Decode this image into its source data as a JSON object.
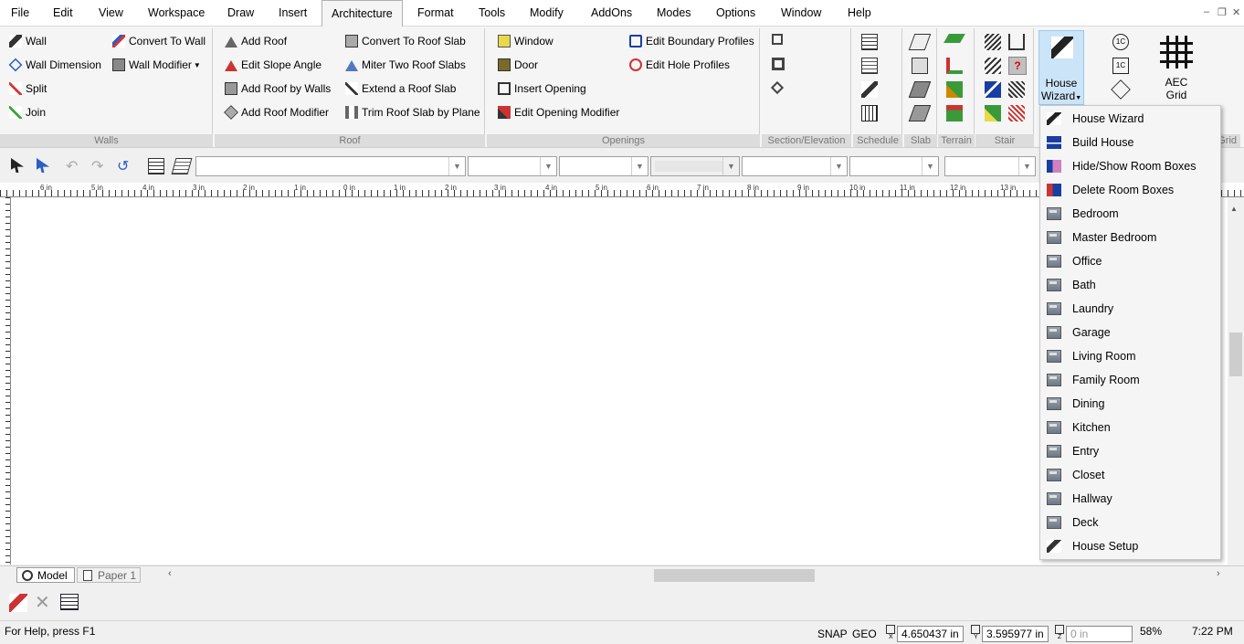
{
  "menu": {
    "items": [
      "File",
      "Edit",
      "View",
      "Workspace",
      "Draw",
      "Insert",
      "Architecture",
      "Format",
      "Tools",
      "Modify",
      "AddOns",
      "Modes",
      "Options",
      "Window",
      "Help"
    ]
  },
  "window_controls": {
    "minimize": "–",
    "restore": "❐",
    "close": "✕"
  },
  "ribbon": {
    "walls": {
      "label": "Walls",
      "wall": "Wall",
      "wall_dimension": "Wall Dimension",
      "split": "Split",
      "join": "Join",
      "convert_to_wall": "Convert To Wall",
      "wall_modifier": "Wall Modifier"
    },
    "roof": {
      "label": "Roof",
      "add_roof": "Add Roof",
      "edit_slope_angle": "Edit Slope Angle",
      "add_roof_by_walls": "Add Roof by Walls",
      "add_roof_modifier": "Add Roof Modifier",
      "convert_to_roof_slab": "Convert To Roof Slab",
      "miter_two_roof_slabs": "Miter Two Roof Slabs",
      "extend_a_roof_slab": "Extend a Roof Slab",
      "trim_roof_slab_by_plane": "Trim Roof Slab by Plane"
    },
    "openings": {
      "label": "Openings",
      "window": "Window",
      "door": "Door",
      "insert_opening": "Insert Opening",
      "edit_opening_modifier": "Edit Opening Modifier",
      "edit_boundary_profiles": "Edit Boundary Profiles",
      "edit_hole_profiles": "Edit Hole Profiles"
    },
    "section": {
      "label": "Section/Elevation"
    },
    "schedule": {
      "label": "Schedule"
    },
    "slab": {
      "label": "Slab"
    },
    "terrain": {
      "label": "Terrain"
    },
    "stair": {
      "label": "Stair"
    },
    "house_wizard": {
      "label_line1": "House",
      "label_line2": "Wizard"
    },
    "aec_grid": {
      "label_line1": "AEC",
      "label_line2": "Grid",
      "group_label_partial": "Grid"
    }
  },
  "ruler": {
    "labels": [
      "6 in",
      "5 in",
      "4 in",
      "3 in",
      "2 in",
      "1 in",
      "0 in",
      "1 in",
      "2 in",
      "3 in",
      "4 in",
      "5 in",
      "6 in",
      "7 in",
      "8 in",
      "9 in",
      "10 in",
      "11 in",
      "12 in",
      "13 in"
    ]
  },
  "tabs": {
    "model": "Model",
    "paper1": "Paper 1"
  },
  "status": {
    "help": "For Help, press F1",
    "snap": "SNAP",
    "geo": "GEO",
    "x_label": "X",
    "x_value": "4.650437 in",
    "y_label": "Y",
    "y_value": "3.595977 in",
    "z_label": "Z",
    "z_placeholder": "0 in",
    "zoom": "58%",
    "time": "7:22 PM"
  },
  "dropdown": {
    "items": [
      "House Wizard",
      "Build House",
      "Hide/Show Room Boxes",
      "Delete Room Boxes",
      "Bedroom",
      "Master Bedroom",
      "Office",
      "Bath",
      "Laundry",
      "Garage",
      "Living Room",
      "Family Room",
      "Dining",
      "Kitchen",
      "Entry",
      "Closet",
      "Hallway",
      "Deck",
      "House Setup"
    ]
  }
}
